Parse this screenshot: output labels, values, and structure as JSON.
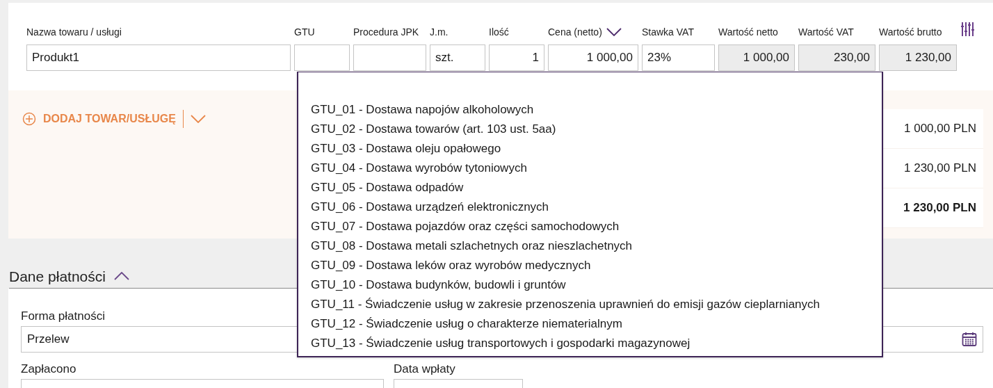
{
  "items_table": {
    "columns": [
      {
        "label": "Nazwa towaru / usługi",
        "kind": "plain"
      },
      {
        "label": "GTU",
        "kind": "plain"
      },
      {
        "label": "Procedura JPK",
        "kind": "plain"
      },
      {
        "label": "J.m.",
        "kind": "plain"
      },
      {
        "label": "Ilość",
        "kind": "plain"
      },
      {
        "label": "Cena (netto)",
        "kind": "menu"
      },
      {
        "label": "Stawka VAT",
        "kind": "plain"
      },
      {
        "label": "Wartość netto",
        "kind": "plain"
      },
      {
        "label": "Wartość VAT",
        "kind": "plain"
      },
      {
        "label": "Wartość brutto",
        "kind": "plain"
      }
    ],
    "row": [
      {
        "value": "Produkt1",
        "readonly": false
      },
      {
        "readonly": false
      },
      {
        "readonly": false
      },
      {
        "value": "szt.",
        "readonly": false
      },
      {
        "value": "1",
        "readonly": false
      },
      {
        "value": "1 000,00",
        "readonly": false
      },
      {
        "value": "23%",
        "readonly": false
      },
      {
        "value": "1 000,00",
        "readonly": true
      },
      {
        "value": "230,00",
        "readonly": true
      },
      {
        "value": "1 230,00",
        "readonly": true
      }
    ]
  },
  "add_item": {
    "label": "DODAJ TOWAR/USŁUGĘ"
  },
  "totals": [
    {
      "value": "1 000,00 PLN",
      "bold": false
    },
    {
      "value": "1 230,00 PLN",
      "bold": false
    },
    {
      "value": "1 230,00 PLN",
      "bold": true
    }
  ],
  "gtu_dropdown": {
    "options": [
      {
        "label": "GTU_01 - Dostawa napojów alkoholowych"
      },
      {
        "label": "GTU_02 - Dostawa towarów (art. 103 ust. 5aa)"
      },
      {
        "label": "GTU_03 - Dostawa oleju opałowego"
      },
      {
        "label": "GTU_04 - Dostawa wyrobów tytoniowych"
      },
      {
        "label": "GTU_05 - Dostawa odpadów"
      },
      {
        "label": "GTU_06 - Dostawa urządzeń elektronicznych"
      },
      {
        "label": "GTU_07 - Dostawa pojazdów oraz części samochodowych"
      },
      {
        "label": "GTU_08 - Dostawa metali szlachetnych oraz nieszlachetnych"
      },
      {
        "label": "GTU_09 - Dostawa leków oraz wyrobów medycznych"
      },
      {
        "label": "GTU_10 - Dostawa budynków, budowli i gruntów"
      },
      {
        "label": "GTU_11 - Świadczenie usług w zakresie przenoszenia uprawnień do emisji gazów cieplarnianych"
      },
      {
        "label": "GTU_12 - Świadczenie usług o charakterze niematerialnym"
      },
      {
        "label": "GTU_13 - Świadczenie usług transportowych i gospodarki magazynowej"
      }
    ]
  },
  "payment": {
    "title": "Dane płatności",
    "expanded": true,
    "payment_method": {
      "label": "Forma płatności",
      "value": "Przelew"
    },
    "paid": {
      "label": "Zapłacono"
    },
    "payment_date": {
      "label": "Data wpłaty"
    }
  }
}
